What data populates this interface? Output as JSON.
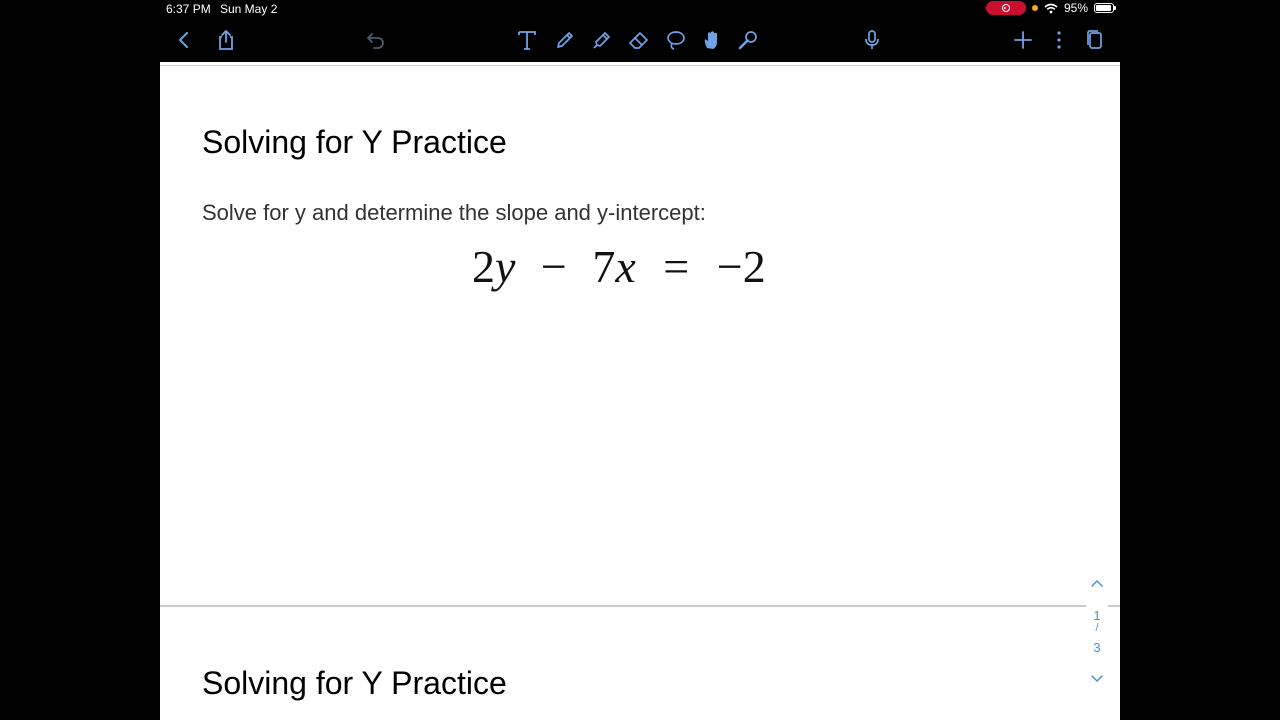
{
  "status": {
    "time": "6:37 PM",
    "date": "Sun May 2",
    "battery": "95%",
    "battery_level": 0.95
  },
  "toolbar": {
    "left": [
      "back-icon",
      "share-icon",
      "undo-icon"
    ],
    "tools": [
      "text-tool-icon",
      "pen-tool-icon",
      "highlighter-tool-icon",
      "eraser-tool-icon",
      "lasso-tool-icon",
      "hand-tool-icon",
      "laser-pointer-icon"
    ],
    "right": [
      "microphone-icon",
      "add-icon",
      "more-icon",
      "pages-icon"
    ],
    "accent": "#6fa3e6"
  },
  "document": {
    "page1_title": "Solving for Y Practice",
    "prompt": "Solve for y and determine the slope and y-intercept:",
    "equation": {
      "coef_y": "2",
      "var_y": "y",
      "minus": "−",
      "coef_x": "7",
      "var_x": "x",
      "equals": "=",
      "rhs": "−2"
    },
    "page2_title": "Solving for Y Practice"
  },
  "pager": {
    "current": "1",
    "separator": "/",
    "total": "3"
  }
}
